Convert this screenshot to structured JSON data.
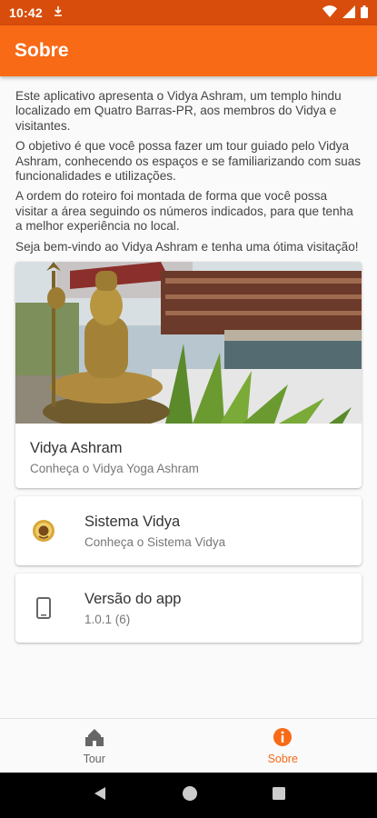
{
  "status_bar": {
    "time": "10:42"
  },
  "app_bar": {
    "title": "Sobre"
  },
  "intro": {
    "paragraphs": [
      "Este aplicativo apresenta o Vidya Ashram, um templo hindu localizado em Quatro Barras-PR, aos membros do Vidya e visitantes.",
      "O objetivo é que você possa fazer um tour guiado pelo Vidya Ashram, conhecendo os espaços e se familiarizando com suas funcionalidades e utilizações.",
      "A ordem do roteiro foi montada de forma que você possa visitar a área seguindo os números indicados, para que tenha a melhor experiência no local.",
      "Seja bem-vindo ao Vidya Ashram e tenha uma ótima visitação!"
    ]
  },
  "cards": {
    "ashram": {
      "title": "Vidya Ashram",
      "subtitle": "Conheça o Vidya Yoga Ashram"
    },
    "sistema": {
      "title": "Sistema Vidya",
      "subtitle": "Conheça o Sistema Vidya",
      "icon": "vidya-logo-icon"
    },
    "versao": {
      "title": "Versão do app",
      "subtitle": "1.0.1 (6)",
      "icon": "phone-icon"
    }
  },
  "bottom_nav": {
    "items": [
      {
        "label": "Tour",
        "icon": "castle-icon",
        "active": false
      },
      {
        "label": "Sobre",
        "icon": "info-icon",
        "active": true
      }
    ]
  },
  "colors": {
    "primary": "#f86a16",
    "status_bar": "#d84d0b",
    "background": "#fafafa"
  }
}
